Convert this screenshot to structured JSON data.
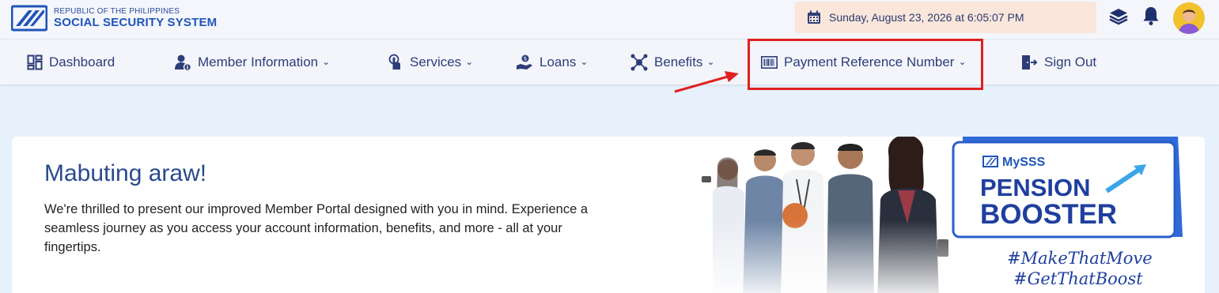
{
  "header": {
    "org_small": "REPUBLIC OF THE PHILIPPINES",
    "org_big": "SOCIAL SECURITY SYSTEM",
    "datetime": "Sunday, August 23, 2026 at 6:05:07 PM",
    "icons": [
      "calendar-icon",
      "layers-icon",
      "bell-icon",
      "avatar"
    ]
  },
  "nav": {
    "items": [
      {
        "label": "Dashboard",
        "icon": "dashboard-icon",
        "dropdown": false
      },
      {
        "label": "Member Information",
        "icon": "user-info-icon",
        "dropdown": true
      },
      {
        "label": "Services",
        "icon": "tap-icon",
        "dropdown": true
      },
      {
        "label": "Loans",
        "icon": "hand-money-icon",
        "dropdown": true
      },
      {
        "label": "Benefits",
        "icon": "network-icon",
        "dropdown": true
      },
      {
        "label": "Payment Reference Number",
        "icon": "barcode-icon",
        "dropdown": true
      },
      {
        "label": "Sign Out",
        "icon": "sign-out-icon",
        "dropdown": false
      }
    ]
  },
  "welcome": {
    "title": "Mabuting araw!",
    "body": "We're thrilled to present our improved Member Portal designed with you in mind. Experience a seamless journey as you access your account information, benefits, and more - all at your fingertips."
  },
  "promo": {
    "brand": "MySSS",
    "line1": "PENSION",
    "line2": "BOOSTER",
    "tag1": "#MakeThatMove",
    "tag2": "#GetThatBoost"
  },
  "colors": {
    "accent": "#1f55b8",
    "nav_text": "#2d3d78",
    "highlight": "#e02020",
    "date_bg": "#fae6db",
    "page_bg": "#e6f1fb"
  }
}
